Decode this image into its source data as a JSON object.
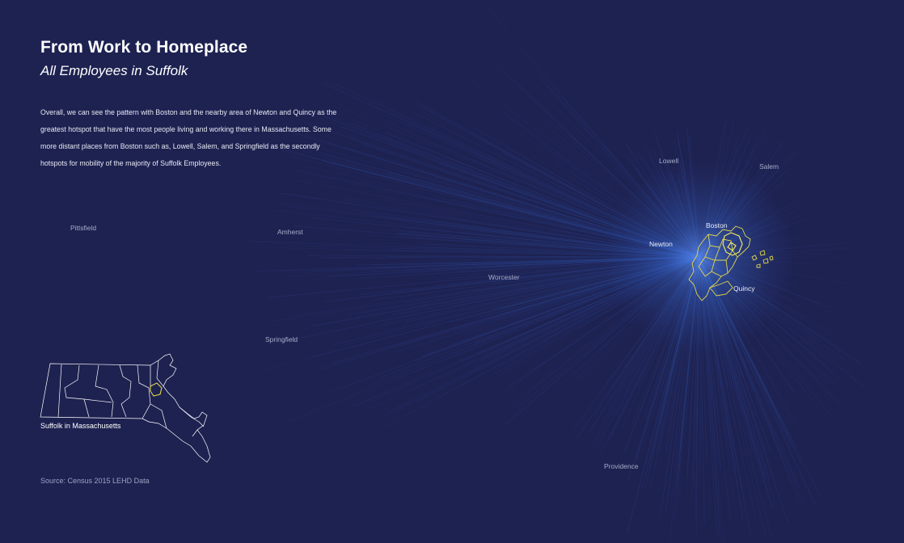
{
  "title": "From Work to Homeplace",
  "subtitle": "All Employees in Suffolk",
  "description": "Overall, we can see the pattern with Boston and the nearby area of Newton and Quincy as the greatest hotspot that have the most people living and working there in Massachusetts. Some more distant places from Boston such as, Lowell, Salem, and Springfield as the secondly hotspots for mobility of the majority of Suffolk Employees.",
  "inset_label": "Suffolk in Massachusetts",
  "source": "Source: Census 2015 LEHD Data",
  "places": {
    "lowell": "Lowell",
    "salem": "Salem",
    "pittsfield": "Pittsfield",
    "amherst": "Amherst",
    "boston": "Boston",
    "newton": "Newton",
    "worcester": "Worcester",
    "quincy": "Quincy",
    "springfield": "Springfield",
    "providence": "Providence"
  },
  "colors": {
    "background": "#1e2251",
    "flow": "#3d6fd6",
    "boundary_highlight": "#e3d84a",
    "boundary_outline": "#ffffff"
  }
}
